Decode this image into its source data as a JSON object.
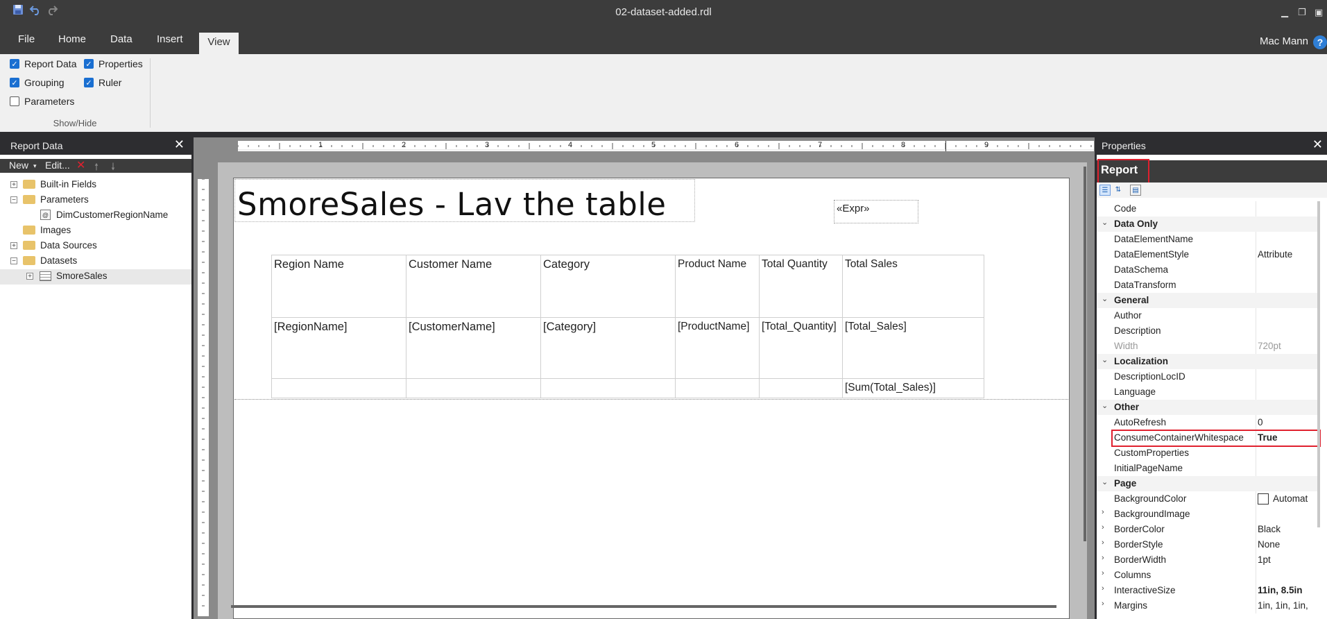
{
  "window": {
    "title": "02-dataset-added.rdl"
  },
  "menu": {
    "tabs": [
      "File",
      "Home",
      "Data",
      "Insert",
      "View"
    ],
    "user": "Mac Mann",
    "help_glyph": "?"
  },
  "ribbon": {
    "show_hide": {
      "label": "Show/Hide",
      "report_data": "Report Data",
      "grouping": "Grouping",
      "parameters": "Parameters",
      "properties": "Properties",
      "ruler": "Ruler"
    }
  },
  "report_data_panel": {
    "title": "Report Data",
    "toolbar": {
      "new": "New",
      "edit": "Edit..."
    },
    "tree": {
      "built_in_fields": "Built-in Fields",
      "parameters": "Parameters",
      "param_1": "DimCustomerRegionName",
      "images": "Images",
      "data_sources": "Data Sources",
      "datasets": "Datasets",
      "dataset_1": "SmoreSales"
    }
  },
  "canvas": {
    "report_title": "SmoreSales - Lav the table",
    "expr": "«Expr»",
    "ruler_numbers": [
      "1",
      "2",
      "3",
      "4",
      "5",
      "6",
      "7",
      "8",
      "9"
    ],
    "table": {
      "headers": [
        "Region Name",
        "Customer Name",
        "Category",
        "Product Name",
        "Total Quantity",
        "Total Sales"
      ],
      "detail": [
        "[RegionName]",
        "[CustomerName]",
        "[Category]",
        "[ProductName]",
        "[Total_Quantity]",
        "[Total_Sales]"
      ],
      "total": "[Sum(Total_Sales)]"
    }
  },
  "properties_panel": {
    "title": "Properties",
    "object_name": "Report",
    "rows": {
      "code": "Code",
      "cat_data_only": "Data Only",
      "data_element_name": "DataElementName",
      "data_element_style": "DataElementStyle",
      "data_element_style_v": "Attribute",
      "data_schema": "DataSchema",
      "data_transform": "DataTransform",
      "cat_general": "General",
      "author": "Author",
      "description": "Description",
      "width": "Width",
      "width_v": "720pt",
      "cat_localization": "Localization",
      "description_loc_id": "DescriptionLocID",
      "language": "Language",
      "cat_other": "Other",
      "auto_refresh": "AutoRefresh",
      "auto_refresh_v": "0",
      "consume_ws": "ConsumeContainerWhitespace",
      "consume_ws_v": "True",
      "custom_properties": "CustomProperties",
      "initial_page_name": "InitialPageName",
      "cat_page": "Page",
      "background_color": "BackgroundColor",
      "background_color_v": "Automat",
      "background_image": "BackgroundImage",
      "border_color": "BorderColor",
      "border_color_v": "Black",
      "border_style": "BorderStyle",
      "border_style_v": "None",
      "border_width": "BorderWidth",
      "border_width_v": "1pt",
      "columns": "Columns",
      "interactive_size": "InteractiveSize",
      "interactive_size_v": "11in, 8.5in",
      "margins": "Margins",
      "margins_v": "1in, 1in, 1in,"
    }
  },
  "colors": {
    "highlight": "#e0202e",
    "accent": "#1a6fd1"
  }
}
